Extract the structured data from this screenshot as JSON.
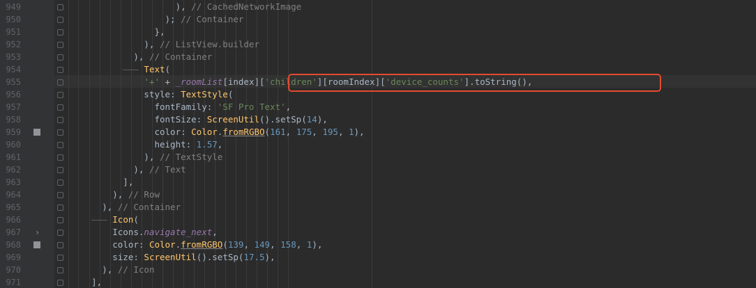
{
  "editor": {
    "lines": [
      {
        "n": "949",
        "indent": "",
        "parts": [
          {
            "c": "",
            "t": "                      ), "
          },
          {
            "c": "cmt",
            "t": "// CachedNetworkImage"
          }
        ]
      },
      {
        "n": "950",
        "parts": [
          {
            "c": "",
            "t": "                    ); "
          },
          {
            "c": "cmt",
            "t": "// Container"
          }
        ]
      },
      {
        "n": "951",
        "parts": [
          {
            "c": "",
            "t": "                  },"
          }
        ]
      },
      {
        "n": "952",
        "parts": [
          {
            "c": "",
            "t": "                ), "
          },
          {
            "c": "cmt",
            "t": "// ListView.builder"
          }
        ]
      },
      {
        "n": "953",
        "parts": [
          {
            "c": "",
            "t": "              ), "
          },
          {
            "c": "cmt",
            "t": "// Container"
          }
        ]
      },
      {
        "n": "954",
        "parts": [
          {
            "c": "tree",
            "t": "            ——— "
          },
          {
            "c": "yel",
            "t": "Text"
          },
          {
            "c": "",
            "t": "("
          }
        ]
      },
      {
        "n": "955",
        "parts": [
          {
            "c": "",
            "t": "                "
          },
          {
            "c": "str",
            "t": "'+'"
          },
          {
            "c": "",
            "t": " + "
          },
          {
            "c": "prp",
            "t": "_roomList"
          },
          {
            "c": "",
            "t": "[index]["
          },
          {
            "c": "str",
            "t": "'children'"
          },
          {
            "c": "",
            "t": "][roomIndex]["
          },
          {
            "c": "str",
            "t": "'device_counts'"
          },
          {
            "c": "",
            "t": "].toString(),"
          }
        ]
      },
      {
        "n": "956",
        "parts": [
          {
            "c": "",
            "t": "                style: "
          },
          {
            "c": "yel",
            "t": "TextStyle"
          },
          {
            "c": "",
            "t": "("
          }
        ]
      },
      {
        "n": "957",
        "parts": [
          {
            "c": "",
            "t": "                  fontFamily: "
          },
          {
            "c": "str",
            "t": "'SF Pro Text'"
          },
          {
            "c": "",
            "t": ","
          }
        ]
      },
      {
        "n": "958",
        "parts": [
          {
            "c": "",
            "t": "                  fontSize: "
          },
          {
            "c": "yel",
            "t": "ScreenUtil"
          },
          {
            "c": "",
            "t": "().setSp("
          },
          {
            "c": "numc",
            "t": "14"
          },
          {
            "c": "",
            "t": "),"
          }
        ]
      },
      {
        "n": "959",
        "parts": [
          {
            "c": "",
            "t": "                  color: "
          },
          {
            "c": "yel",
            "t": "Color"
          },
          {
            "c": "",
            "t": "."
          },
          {
            "c": "yel ul",
            "t": "fromRGBO"
          },
          {
            "c": "",
            "t": "("
          },
          {
            "c": "numc",
            "t": "161"
          },
          {
            "c": "",
            "t": ", "
          },
          {
            "c": "numc",
            "t": "175"
          },
          {
            "c": "",
            "t": ", "
          },
          {
            "c": "numc",
            "t": "195"
          },
          {
            "c": "",
            "t": ", "
          },
          {
            "c": "numc",
            "t": "1"
          },
          {
            "c": "",
            "t": "),"
          }
        ]
      },
      {
        "n": "960",
        "parts": [
          {
            "c": "",
            "t": "                  height: "
          },
          {
            "c": "numc",
            "t": "1.57"
          },
          {
            "c": "",
            "t": ","
          }
        ]
      },
      {
        "n": "961",
        "parts": [
          {
            "c": "",
            "t": "                ), "
          },
          {
            "c": "cmt",
            "t": "// TextStyle"
          }
        ]
      },
      {
        "n": "962",
        "parts": [
          {
            "c": "",
            "t": "              ), "
          },
          {
            "c": "cmt",
            "t": "// Text"
          }
        ]
      },
      {
        "n": "963",
        "parts": [
          {
            "c": "",
            "t": "            ],"
          }
        ]
      },
      {
        "n": "964",
        "parts": [
          {
            "c": "",
            "t": "          ), "
          },
          {
            "c": "cmt",
            "t": "// Row"
          }
        ]
      },
      {
        "n": "965",
        "parts": [
          {
            "c": "",
            "t": "        ), "
          },
          {
            "c": "cmt",
            "t": "// Container"
          }
        ]
      },
      {
        "n": "966",
        "parts": [
          {
            "c": "tree",
            "t": "      ——— "
          },
          {
            "c": "yel",
            "t": "Icon"
          },
          {
            "c": "",
            "t": "("
          }
        ]
      },
      {
        "n": "967",
        "parts": [
          {
            "c": "",
            "t": "          Icons."
          },
          {
            "c": "prp",
            "t": "navigate_next"
          },
          {
            "c": "",
            "t": ","
          }
        ]
      },
      {
        "n": "968",
        "parts": [
          {
            "c": "",
            "t": "          color: "
          },
          {
            "c": "yel",
            "t": "Color"
          },
          {
            "c": "",
            "t": "."
          },
          {
            "c": "yel ul",
            "t": "fromRGBO"
          },
          {
            "c": "",
            "t": "("
          },
          {
            "c": "numc",
            "t": "139"
          },
          {
            "c": "",
            "t": ", "
          },
          {
            "c": "numc",
            "t": "149"
          },
          {
            "c": "",
            "t": ", "
          },
          {
            "c": "numc",
            "t": "158"
          },
          {
            "c": "",
            "t": ", "
          },
          {
            "c": "numc",
            "t": "1"
          },
          {
            "c": "",
            "t": "),"
          }
        ]
      },
      {
        "n": "969",
        "parts": [
          {
            "c": "",
            "t": "          size: "
          },
          {
            "c": "yel",
            "t": "ScreenUtil"
          },
          {
            "c": "",
            "t": "().setSp("
          },
          {
            "c": "numc",
            "t": "17.5"
          },
          {
            "c": "",
            "t": "),"
          }
        ]
      },
      {
        "n": "970",
        "parts": [
          {
            "c": "",
            "t": "        ), "
          },
          {
            "c": "cmt",
            "t": "// Icon"
          }
        ]
      },
      {
        "n": "971",
        "parts": [
          {
            "c": "",
            "t": "      ],"
          }
        ]
      }
    ],
    "markers": [
      "959",
      "968"
    ],
    "fold_chevron_line": "967",
    "chevron_glyph": "›"
  }
}
